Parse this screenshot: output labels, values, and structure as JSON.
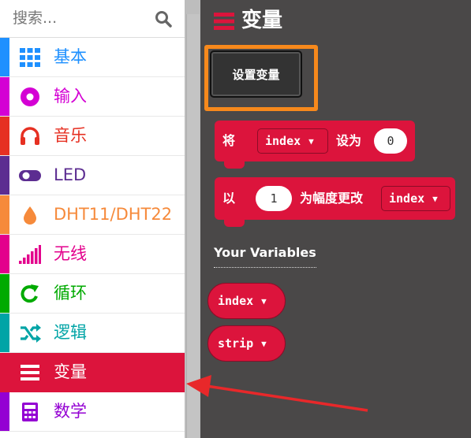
{
  "search": {
    "placeholder": "搜索..."
  },
  "categories": [
    {
      "label": "基本",
      "color": "#1e90ff",
      "icon": "grid-icon"
    },
    {
      "label": "输入",
      "color": "#d400d4",
      "icon": "target-icon"
    },
    {
      "label": "音乐",
      "color": "#e63022",
      "icon": "headphones-icon"
    },
    {
      "label": "LED",
      "color": "#5c2d91",
      "icon": "toggle-icon"
    },
    {
      "label": "DHT11/DHT22",
      "color": "#f68a3b",
      "icon": "droplet-icon"
    },
    {
      "label": "无线",
      "color": "#e3008c",
      "icon": "signal-icon"
    },
    {
      "label": "循环",
      "color": "#00aa00",
      "icon": "refresh-icon"
    },
    {
      "label": "逻辑",
      "color": "#00a4a6",
      "icon": "shuffle-icon"
    },
    {
      "label": "变量",
      "color": "#dc143c",
      "icon": "list-icon",
      "selected": true
    },
    {
      "label": "数学",
      "color": "#9400d3",
      "icon": "calculator-icon"
    }
  ],
  "flyout": {
    "title": "变量",
    "make_variable_button": "设置变量",
    "set_block": {
      "prefix": "将",
      "variable": "index",
      "middle": "设为",
      "value": "0"
    },
    "change_block": {
      "prefix": "以",
      "value": "1",
      "middle": "为幅度更改",
      "variable": "index"
    },
    "section_title": "Your Variables",
    "variables": [
      "index",
      "strip"
    ]
  },
  "colors": {
    "accent": "#dc143c",
    "highlight": "#f7891c",
    "flyout_bg": "#4a4848"
  }
}
